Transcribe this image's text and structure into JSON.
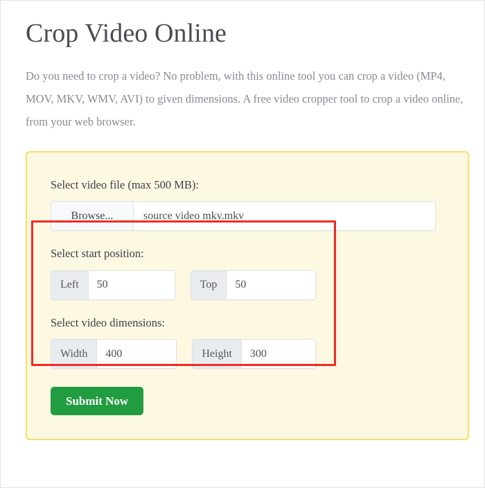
{
  "page": {
    "title": "Crop Video Online",
    "description": "Do you need to crop a video? No problem, with this online tool you can crop a video (MP4, MOV, MKV, WMV, AVI) to given dimensions. A free video cropper tool to crop a video online, from your web browser."
  },
  "form": {
    "file": {
      "label": "Select video file (max 500 MB):",
      "browse_label": "Browse...",
      "file_name": "source video mkv.mkv"
    },
    "start_position": {
      "label": "Select start position:",
      "fields": [
        {
          "addon": "Left",
          "value": "50"
        },
        {
          "addon": "Top",
          "value": "50"
        }
      ]
    },
    "dimensions": {
      "label": "Select video dimensions:",
      "fields": [
        {
          "addon": "Width",
          "value": "400"
        },
        {
          "addon": "Height",
          "value": "300"
        }
      ]
    },
    "submit_label": "Submit Now"
  },
  "annotation": {
    "highlight_color": "#ee2b24"
  },
  "colors": {
    "card_border": "#f6de63",
    "card_background": "#fdf8e2",
    "submit_green": "#219c41",
    "addon_gray": "#e9ecef",
    "title_text": "#4a4a52",
    "description_text": "#8a8a92"
  }
}
